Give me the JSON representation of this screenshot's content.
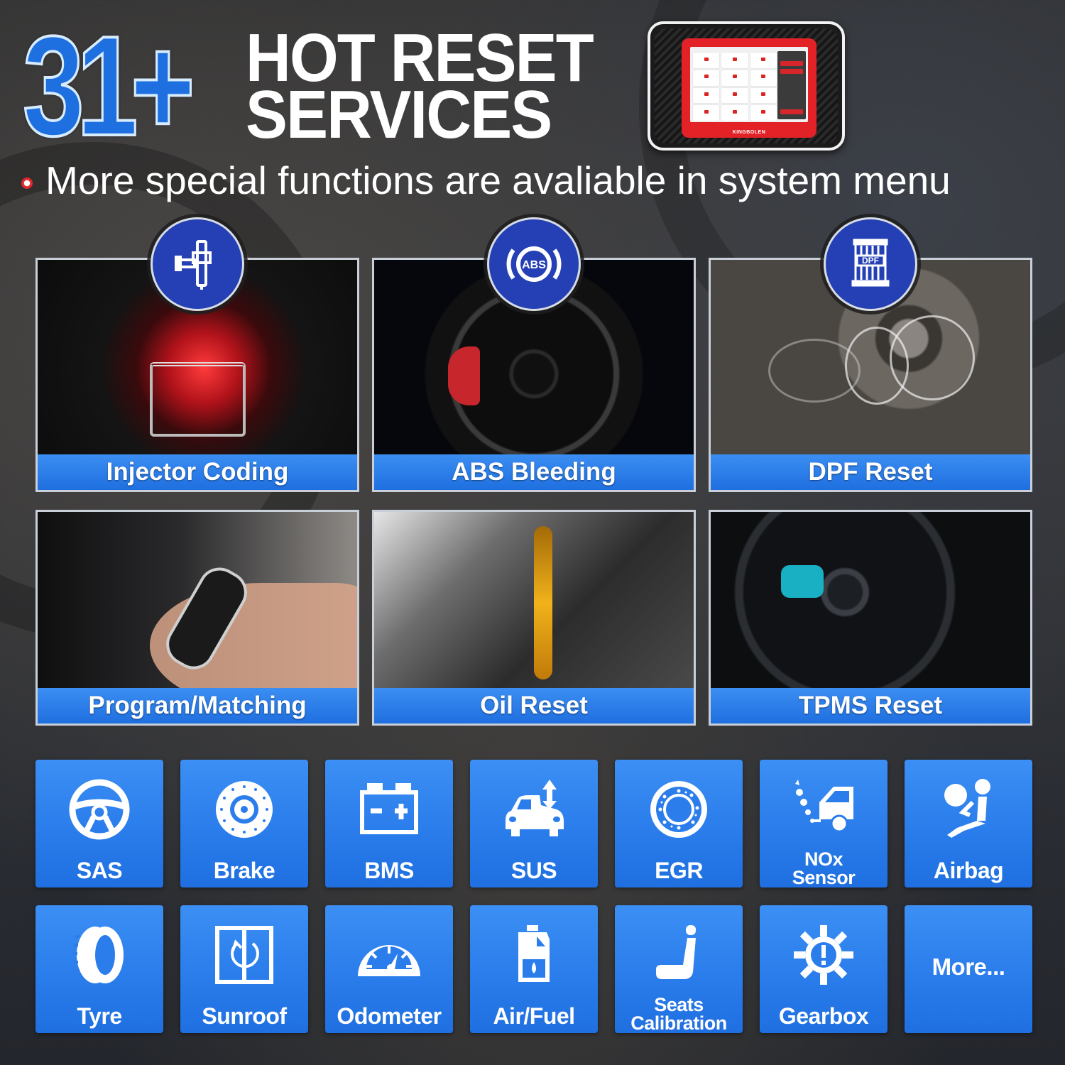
{
  "header": {
    "count": "31+",
    "title_line1": "HOT RESET",
    "title_line2": "SERVICES",
    "subtitle": "More special functions are avaliable in system menu"
  },
  "device": {
    "brand": "KINGBOLEN",
    "screen_tiles": 12,
    "side_buttons": 2
  },
  "feature_cards": [
    {
      "label": "Injector Coding",
      "icon": "fuel-injector-icon",
      "image": "engine-piston-combustion"
    },
    {
      "label": "ABS Bleeding",
      "icon": "abs-icon",
      "badge_text": "ABS",
      "image": "wheel-red-brake-caliper"
    },
    {
      "label": "DPF Reset",
      "icon": "dpf-filter-icon",
      "badge_text": "DPF",
      "image": "exhaust-smoke"
    },
    {
      "label": "Program/Matching",
      "image": "car-key-fob-in-hand"
    },
    {
      "label": "Oil Reset",
      "image": "engine-oil-pouring"
    },
    {
      "label": "TPMS Reset",
      "image": "tyre-impact-wrench"
    }
  ],
  "functions": [
    {
      "label": "SAS",
      "icon": "steering-wheel-icon"
    },
    {
      "label": "Brake",
      "icon": "brake-disc-icon"
    },
    {
      "label": "BMS",
      "icon": "battery-icon"
    },
    {
      "label": "SUS",
      "icon": "car-suspension-icon"
    },
    {
      "label": "EGR",
      "icon": "egr-ring-icon"
    },
    {
      "label": "NOx Sensor",
      "label_line1": "NOx",
      "label_line2": "Sensor",
      "icon": "exhaust-emission-car-icon"
    },
    {
      "label": "Airbag",
      "icon": "airbag-icon"
    },
    {
      "label": "Tyre",
      "icon": "tyre-icon"
    },
    {
      "label": "Sunroof",
      "icon": "sunroof-icon"
    },
    {
      "label": "Odometer",
      "icon": "odometer-gauge-icon"
    },
    {
      "label": "Air/Fuel",
      "icon": "fuel-canister-icon"
    },
    {
      "label": "Seats Calibration",
      "label_line1": "Seats",
      "label_line2": "Calibration",
      "icon": "seat-icon"
    },
    {
      "label": "Gearbox",
      "icon": "gear-warning-icon"
    },
    {
      "label": "More...",
      "icon": ""
    }
  ],
  "colors": {
    "accent_blue": "#2a7deb",
    "badge_blue": "#2540b4",
    "device_red": "#e32228",
    "background": "#2b2b2c"
  }
}
